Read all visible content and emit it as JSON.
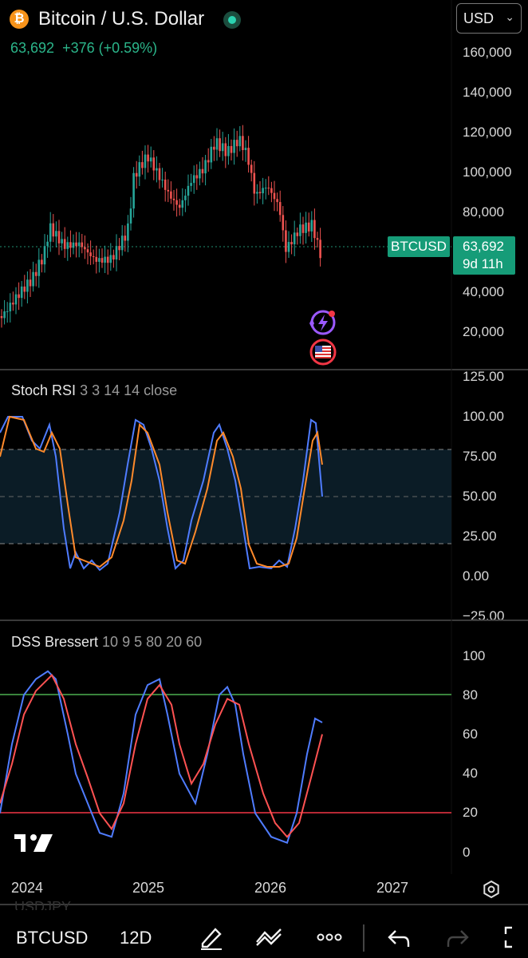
{
  "header": {
    "title": "Bitcoin / U.S. Dollar",
    "price": "63,692",
    "change": "+376 (+0.59%)",
    "currency": "USD"
  },
  "price_chart": {
    "axis_labels": [
      "160,000",
      "140,000",
      "120,000",
      "100,000",
      "80,000",
      "60,000",
      "40,000",
      "20,000"
    ],
    "symbol_tag": "BTCUSD",
    "last_price": "63,692",
    "countdown": "9d 11h",
    "up_color": "#26a69a",
    "down_color": "#ef5350"
  },
  "stoch_rsi": {
    "name": "Stoch RSI",
    "params": "3 3 14 14 close",
    "axis_labels": [
      "125.00",
      "100.00",
      "75.00",
      "50.00",
      "25.00",
      "0.00",
      "−25.00"
    ],
    "k_color": "#4f7cff",
    "d_color": "#ff8a2b"
  },
  "dss": {
    "name": "DSS Bressert",
    "params": "10 9 5 80 20 60",
    "axis_labels": [
      "100",
      "80",
      "60",
      "40",
      "20",
      "0"
    ],
    "upper_color": "#4caf50",
    "lower_color": "#f23645"
  },
  "time_axis": [
    "2024",
    "2025",
    "2026",
    "2027"
  ],
  "faded_symbol": "USDJPY",
  "bottom_bar": {
    "symbol": "BTCUSD",
    "interval": "12D"
  },
  "chart_data": {
    "type": "candlestick",
    "x": [
      "2024",
      "2025",
      "2026",
      "2027"
    ],
    "ylim": [
      0,
      170000
    ],
    "last": 63692
  }
}
